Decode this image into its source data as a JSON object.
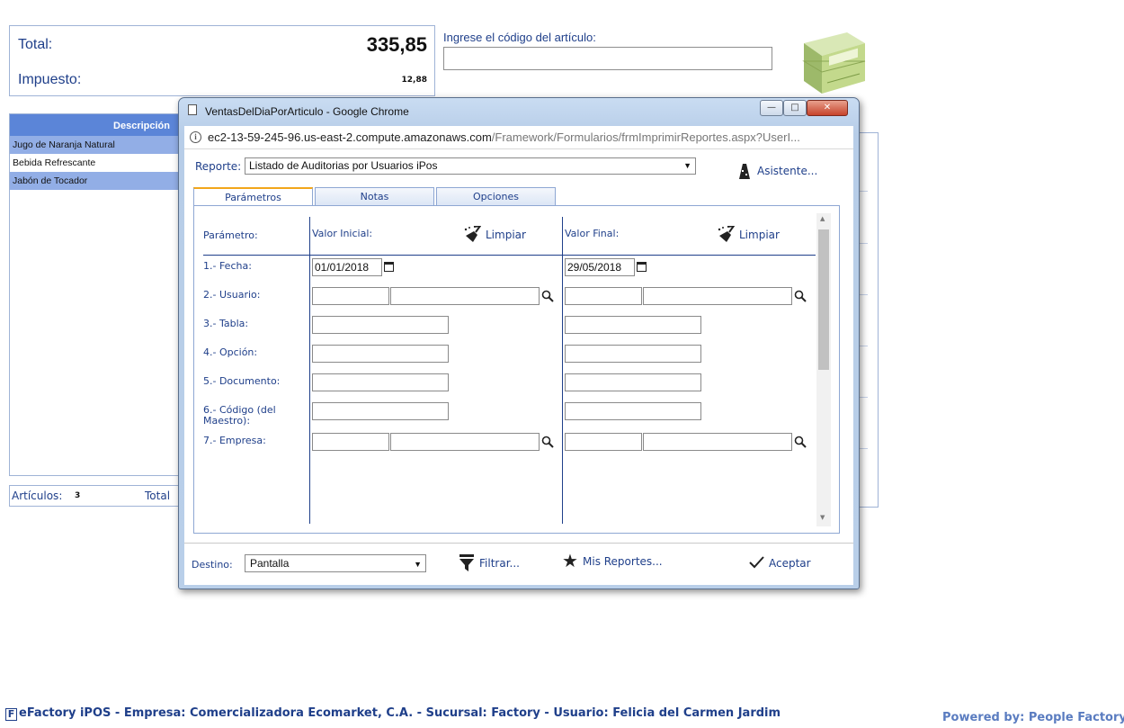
{
  "totals": {
    "total_label": "Total:",
    "total_value": "335,85",
    "tax_label": "Impuesto:",
    "tax_value": "12,88"
  },
  "search": {
    "label": "Ingrese el código del artículo:",
    "value": ""
  },
  "items": {
    "header": "Descripción",
    "rows": [
      "Jugo de Naranja Natural",
      "Bebida Refrescante",
      "Jabón de Tocador"
    ],
    "selected_color": "#92aee6",
    "header_color": "#5b85d8"
  },
  "footer_counts": {
    "articles_label": "Artículos:",
    "articles_count": "3",
    "total_label": "Total"
  },
  "popup": {
    "title": "VentasDelDiaPorArticulo - Google Chrome",
    "url_host": "ec2-13-59-245-96.us-east-2.compute.amazonaws.com",
    "url_path": "/Framework/Formularios/frmImprimirReportes.aspx?UserI...",
    "report_label": "Reporte:",
    "report_value": "Listado de Auditorias por Usuarios iPos",
    "assistant_label": "Asistente...",
    "tabs": [
      "Parámetros",
      "Notas",
      "Opciones"
    ],
    "active_tab": "Parámetros",
    "param_header": "Parámetro:",
    "initial_header": "Valor Inicial:",
    "final_header": "Valor Final:",
    "clear_label": "Limpiar",
    "parameters": [
      {
        "label": "1.- Fecha:",
        "initial": "01/01/2018",
        "final": "29/05/2018"
      },
      {
        "label": "2.- Usuario:",
        "initial": "",
        "final": ""
      },
      {
        "label": "3.- Tabla:",
        "initial": "",
        "final": ""
      },
      {
        "label": "4.- Opción:",
        "initial": "",
        "final": ""
      },
      {
        "label": "5.- Documento:",
        "initial": "",
        "final": ""
      },
      {
        "label": "6.- Código (del Maestro):",
        "initial": "",
        "final": ""
      },
      {
        "label": "7.- Empresa:",
        "initial": "",
        "final": ""
      }
    ],
    "destination_label": "Destino:",
    "destination_value": "Pantalla",
    "filter_label": "Filtrar...",
    "my_reports_label": "Mis Reportes...",
    "accept_label": "Aceptar",
    "accent_color": "#f2a61a"
  },
  "status_bar": {
    "app_letter": "F",
    "text": "eFactory iPOS - Empresa: Comercializadora Ecomarket, C.A. - Sucursal: Factory - Usuario: Felicia del Carmen Jardim",
    "powered": "Powered by: People Factory"
  }
}
